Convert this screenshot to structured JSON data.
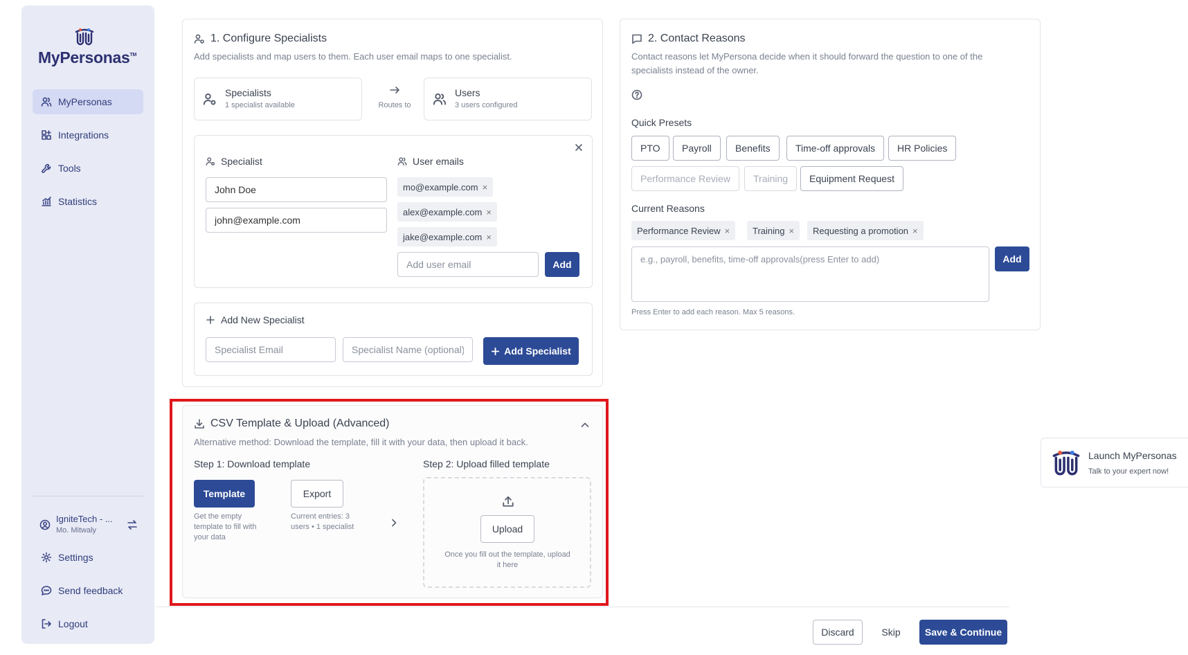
{
  "sidebar": {
    "logo_text": "MyPersonas",
    "logo_tm": "TM",
    "items": [
      {
        "label": "MyPersonas",
        "icon": "users-icon",
        "active": true
      },
      {
        "label": "Integrations",
        "icon": "integrations-icon"
      },
      {
        "label": "Tools",
        "icon": "wrench-icon"
      },
      {
        "label": "Statistics",
        "icon": "chart-icon"
      }
    ],
    "org": {
      "name": "IgniteTech - ...",
      "user": "Mo. Mitwaly"
    },
    "bottom_items": [
      {
        "label": "Settings",
        "icon": "gear-icon"
      },
      {
        "label": "Send feedback",
        "icon": "chat-icon"
      },
      {
        "label": "Logout",
        "icon": "logout-icon"
      }
    ]
  },
  "configure": {
    "title": "1. Configure Specialists",
    "subtitle": "Add specialists and map users to them. Each user email maps to one specialist.",
    "specialists_box": {
      "title": "Specialists",
      "sub": "1 specialist available"
    },
    "routes_to": "Routes to",
    "users_box": {
      "title": "Users",
      "sub": "3 users configured"
    },
    "specialist_label": "Specialist",
    "user_emails_label": "User emails",
    "specialist_name": "John Doe",
    "specialist_email": "john@example.com",
    "emails": [
      "mo@example.com",
      "alex@example.com",
      "jake@example.com"
    ],
    "add_email_placeholder": "Add user email",
    "add_label": "Add",
    "new_specialist": {
      "title": "Add New Specialist",
      "email_placeholder": "Specialist Email",
      "name_placeholder": "Specialist Name (optional)",
      "button": "Add Specialist"
    }
  },
  "csv": {
    "title": "CSV Template & Upload (Advanced)",
    "subtitle": "Alternative method: Download the template, fill it with your data, then upload it back.",
    "step1": "Step 1: Download template",
    "step2": "Step 2: Upload filled template",
    "template_button": "Template",
    "template_help": "Get the empty template to fill with your data",
    "export_button": "Export",
    "export_help": "Current entries: 3 users • 1 specialist",
    "upload_button": "Upload",
    "upload_help": "Once you fill out the template, upload it here"
  },
  "contact": {
    "title": "2. Contact Reasons",
    "subtitle": "Contact reasons let MyPersona decide when it should forward the question to one of the specialists instead of the owner.",
    "quick_presets_label": "Quick Presets",
    "presets_row1": [
      "PTO",
      "Payroll",
      "Benefits",
      "Time-off approvals",
      "HR Policies"
    ],
    "presets_row2": [
      {
        "label": "Performance Review",
        "disabled": true
      },
      {
        "label": "Training",
        "disabled": true
      },
      {
        "label": "Equipment Request",
        "disabled": false
      }
    ],
    "current_reasons_label": "Current Reasons",
    "current_reasons": [
      "Performance Review",
      "Training",
      "Requesting a promotion"
    ],
    "reason_placeholder": "e.g., payroll, benefits, time-off approvals(press Enter to add)",
    "add_label": "Add",
    "hint": "Press Enter to add each reason. Max 5 reasons."
  },
  "footer": {
    "discard": "Discard",
    "skip": "Skip",
    "save": "Save & Continue"
  },
  "launch": {
    "title": "Launch MyPersonas",
    "sub": "Talk to your expert now!"
  },
  "colors": {
    "primary": "#2c4a96",
    "sidebar_bg": "#e8eaf6",
    "highlight": "#e0171b"
  }
}
